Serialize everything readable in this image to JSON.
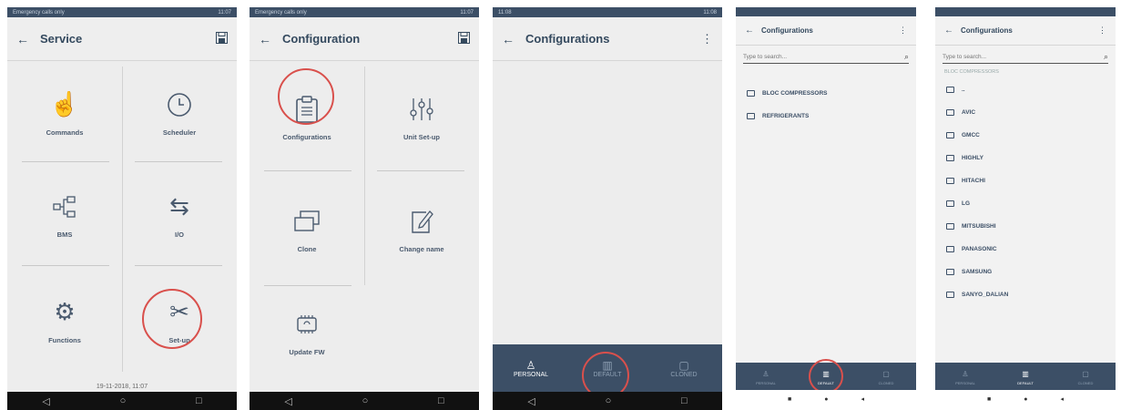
{
  "screen1": {
    "status_left": "Emergency calls only",
    "status_right": "11:07",
    "title": "Service",
    "tiles": [
      {
        "label": "Commands",
        "icon": "hand-pointer-icon"
      },
      {
        "label": "Scheduler",
        "icon": "clock-icon"
      },
      {
        "label": "BMS",
        "icon": "network-icon"
      },
      {
        "label": "I/O",
        "icon": "arrows-icon"
      },
      {
        "label": "Functions",
        "icon": "gear-icon"
      },
      {
        "label": "Set-up",
        "icon": "tools-icon"
      }
    ],
    "datetime": "19-11-2018, 11:07"
  },
  "screen2": {
    "status_left": "Emergency calls only",
    "status_right": "11:07",
    "title": "Configuration",
    "tiles": [
      {
        "label": "Configurations",
        "icon": "clipboard-icon"
      },
      {
        "label": "Unit Set-up",
        "icon": "sliders-icon"
      },
      {
        "label": "Clone",
        "icon": "clone-icon"
      },
      {
        "label": "Change name",
        "icon": "edit-icon"
      },
      {
        "label": "Update FW",
        "icon": "chip-icon"
      }
    ]
  },
  "screen3": {
    "status_left": "11:08",
    "status_right": "11:08",
    "title": "Configurations",
    "tabs": [
      {
        "label": "PERSONAL",
        "icon": "person-icon"
      },
      {
        "label": "DEFAULT",
        "icon": "building-icon"
      },
      {
        "label": "CLONED",
        "icon": "square-icon"
      }
    ]
  },
  "screen4": {
    "title": "Configurations",
    "search_placeholder": "Type to search...",
    "items": [
      "BLOC COMPRESSORS",
      "REFRIGERANTS"
    ],
    "tabs": [
      "PERSONAL",
      "DEFAULT",
      "CLONED"
    ]
  },
  "screen5": {
    "title": "Configurations",
    "search_placeholder": "Type to search...",
    "breadcrumb": "BLOC COMPRESSORS",
    "parent": "..",
    "items": [
      "AVIC",
      "GMCC",
      "HIGHLY",
      "HITACHI",
      "LG",
      "MITSUBISHI",
      "PANASONIC",
      "SAMSUNG",
      "SANYO_DALIAN"
    ],
    "tabs": [
      "PERSONAL",
      "DEFAULT",
      "CLONED"
    ]
  }
}
